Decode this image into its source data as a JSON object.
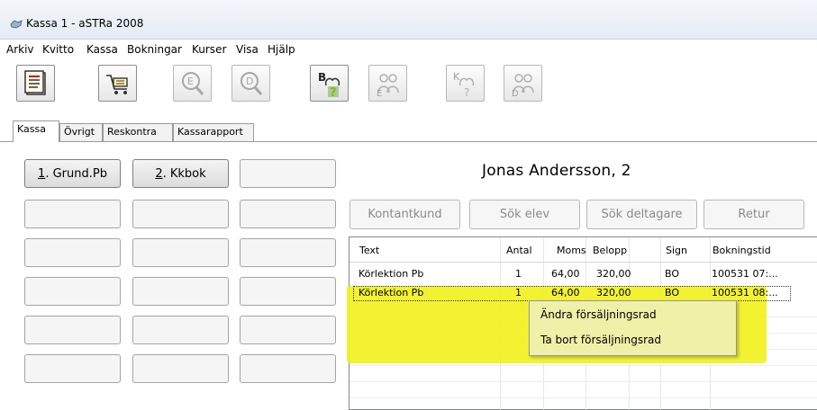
{
  "window": {
    "title": "Kassa 1 - aSTRa 2008",
    "icon": "app-icon"
  },
  "menu": {
    "items": [
      "Arkiv",
      "Kvitto",
      "Kassa",
      "Bokningar",
      "Kurser",
      "Visa",
      "Hjälp"
    ]
  },
  "toolbar": {
    "buttons": [
      {
        "icon": "document-list-icon",
        "enabled": true
      },
      {
        "icon": "shopping-cart-icon",
        "enabled": true
      },
      {
        "icon": "search-e-icon",
        "enabled": false
      },
      {
        "icon": "search-d-icon",
        "enabled": false
      },
      {
        "icon": "booking-b-question-icon",
        "enabled": true
      },
      {
        "icon": "people-e-icon",
        "enabled": false
      },
      {
        "icon": "people-k-question-icon",
        "enabled": false
      },
      {
        "icon": "people-d-icon",
        "enabled": false
      }
    ]
  },
  "tabs": [
    "Kassa",
    "Övrigt",
    "Reskontra",
    "Kassarapport"
  ],
  "active_tab": "Kassa",
  "quick_buttons": {
    "grund": {
      "key": "1",
      "rest": ". Grund.Pb"
    },
    "kkbok": {
      "key": "2",
      "rest": ". Kkbok"
    }
  },
  "customer": {
    "name": "Jonas Andersson, 2"
  },
  "actions": {
    "kontantkund": "Kontantkund",
    "sok_elev": "Sök elev",
    "sok_deltagare": "Sök deltagare",
    "retur": "Retur"
  },
  "sales_table": {
    "headers": {
      "text": "Text",
      "antal": "Antal",
      "moms": "Moms",
      "belopp": "Belopp",
      "sign": "Sign",
      "bokningstid": "Bokningstid"
    },
    "rows": [
      {
        "text": "Körlektion Pb",
        "antal": "1",
        "moms": "64,00",
        "belopp": "320,00",
        "sign": "BO",
        "bokningstid": "100531 07:..."
      },
      {
        "text": "Körlektion Pb",
        "antal": "1",
        "moms": "64,00",
        "belopp": "320,00",
        "sign": "BO",
        "bokningstid": "100531 08:..."
      }
    ]
  },
  "context_menu": {
    "items": [
      "Ändra försäljningsrad",
      "Ta bort försäljningsrad"
    ]
  },
  "colors": {
    "highlight": "#f1f122",
    "context_menu_bg": "#f0f0a8"
  }
}
